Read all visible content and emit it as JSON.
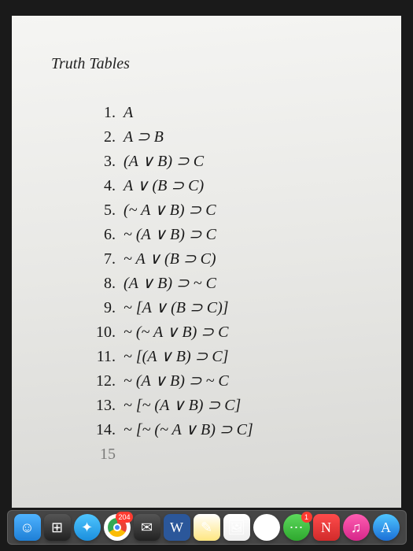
{
  "title": "Truth Tables",
  "items": [
    {
      "num": "1.",
      "expr": "A"
    },
    {
      "num": "2.",
      "expr": "A ⊃ B"
    },
    {
      "num": "3.",
      "expr": "(A ∨ B) ⊃ C"
    },
    {
      "num": "4.",
      "expr": "A ∨ (B ⊃ C)"
    },
    {
      "num": "5.",
      "expr": "(~ A ∨ B) ⊃ C"
    },
    {
      "num": "6.",
      "expr": "~ (A ∨ B) ⊃ C"
    },
    {
      "num": "7.",
      "expr": "~ A ∨ (B ⊃ C)"
    },
    {
      "num": "8.",
      "expr": "(A ∨ B) ⊃ ~ C"
    },
    {
      "num": "9.",
      "expr": "~ [A ∨ (B ⊃ C)]"
    },
    {
      "num": "10.",
      "expr": "~ (~ A ∨ B) ⊃ C"
    },
    {
      "num": "11.",
      "expr": "~ [(A ∨ B) ⊃ C]"
    },
    {
      "num": "12.",
      "expr": "~ (A ∨ B) ⊃ ~ C"
    },
    {
      "num": "13.",
      "expr": "~ [~ (A ∨ B) ⊃ C]"
    },
    {
      "num": "14.",
      "expr": "~ [~ (~ A ∨ B) ⊃ C]"
    }
  ],
  "partial": {
    "num": "15",
    "expr": ""
  },
  "dock": {
    "chrome_badge": "204",
    "messages_badge": "1"
  }
}
